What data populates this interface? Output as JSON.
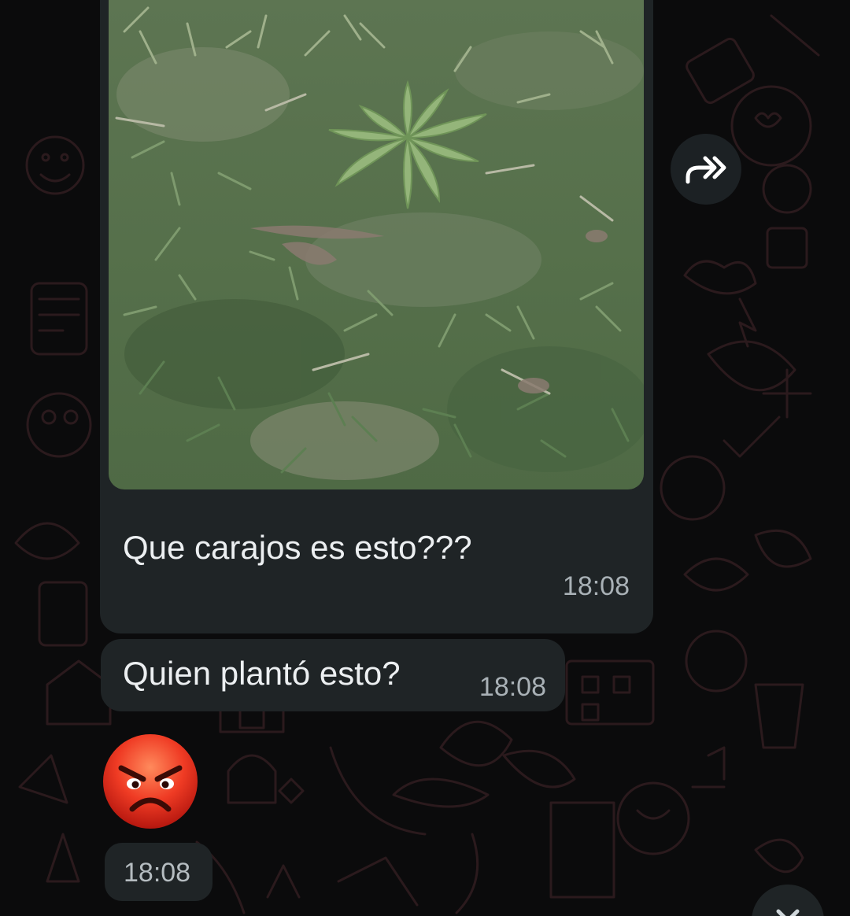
{
  "messages": [
    {
      "type": "image",
      "caption": "Que carajos es esto???",
      "time": "18:08",
      "image_icon": "photo-grass-with-plant"
    },
    {
      "type": "text",
      "text": "Quien plantó esto?",
      "time": "18:08"
    },
    {
      "type": "emoji",
      "emoji_icon": "angry-face-emoji",
      "time": "18:08"
    }
  ],
  "controls": {
    "forward_icon": "forward-arrows-icon",
    "scroll_icon": "chevron-down-icon"
  },
  "colors": {
    "background": "#0b0b0c",
    "bubble": "#1f2426",
    "text": "#eceff1",
    "timestamp": "#a9b1b6",
    "wallpaper_doodles": "#2a1a1c"
  }
}
